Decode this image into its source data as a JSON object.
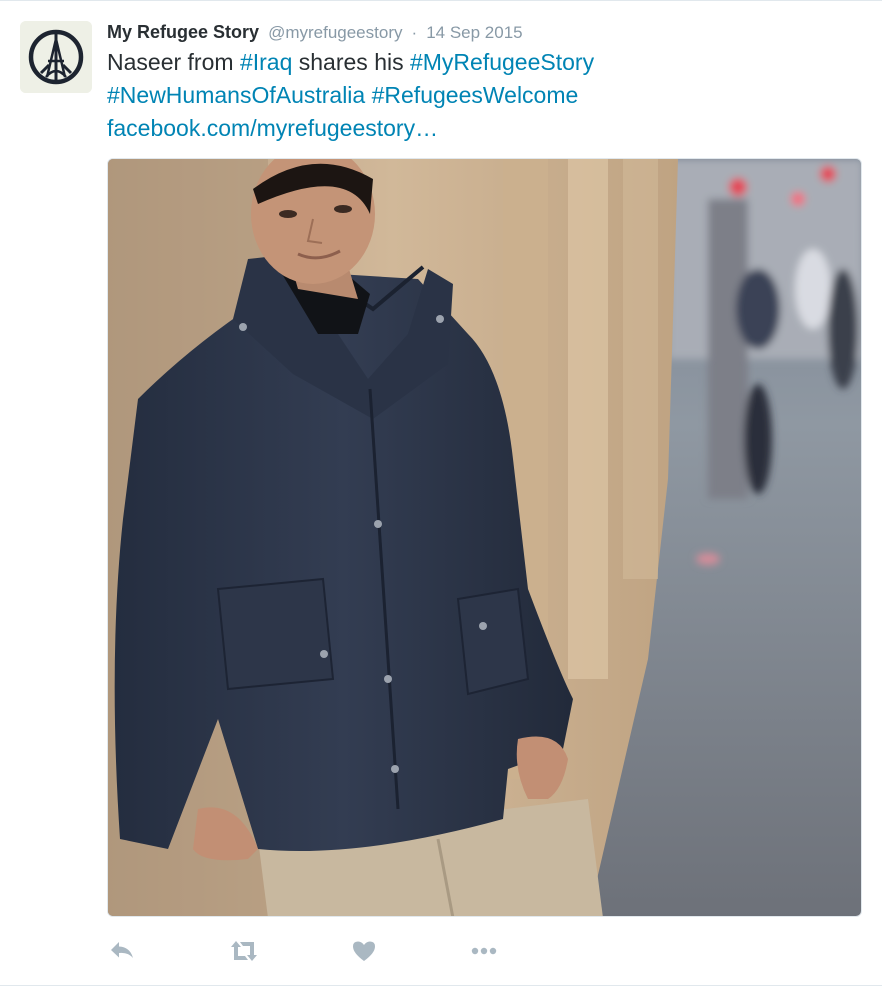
{
  "tweet": {
    "author": {
      "fullname": "My Refugee Story",
      "username": "@myrefugeestory",
      "avatar_icon": "peace-eiffel-tower-icon"
    },
    "separator": "·",
    "timestamp": "14 Sep 2015",
    "text": {
      "line1_prefix": "Naseer from ",
      "hashtag_iraq": "#Iraq",
      "line1_mid": " shares his ",
      "hashtag_story": "#MyRefugeeStory",
      "hashtag_humans": "#NewHumansOfAustralia",
      "hashtag_welcome": "#RefugeesWelcome",
      "link": "facebook.com/myrefugeestory…"
    },
    "media": {
      "icon": "photo-man-in-navy-jacket-leaning-on-wall"
    },
    "actions": [
      {
        "name": "reply",
        "icon": "reply-icon"
      },
      {
        "name": "retweet",
        "icon": "retweet-icon"
      },
      {
        "name": "like",
        "icon": "heart-icon"
      },
      {
        "name": "more",
        "icon": "more-dots-icon"
      }
    ],
    "colors": {
      "link": "#0084b4",
      "text": "#292f33",
      "meta": "#8899a6",
      "action_icon": "#aab8c2"
    }
  }
}
